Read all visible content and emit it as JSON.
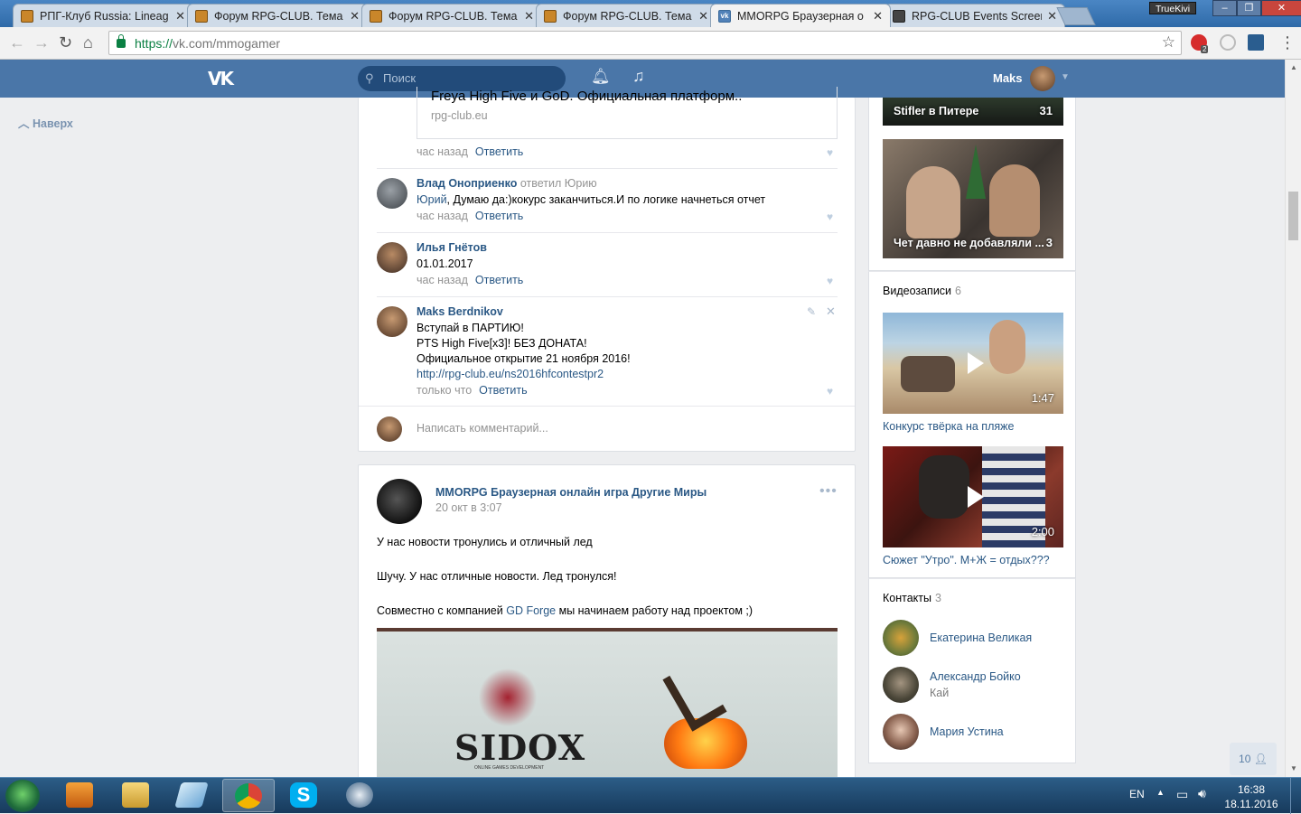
{
  "browser": {
    "tabs": [
      {
        "title": "РПГ-Клуб Russia: Lineag",
        "icon": "rpg-club-icon"
      },
      {
        "title": "Форум RPG-CLUB. Тема",
        "icon": "rpg-club-icon"
      },
      {
        "title": "Форум RPG-CLUB. Тема",
        "icon": "rpg-club-icon"
      },
      {
        "title": "Форум RPG-CLUB. Тема",
        "icon": "rpg-club-icon"
      },
      {
        "title": "MMORPG Браузерная о",
        "icon": "vk-icon"
      },
      {
        "title": "RPG-CLUB Events Screen",
        "icon": "events-icon"
      }
    ],
    "close_glyph": "✕",
    "profile_badge": "TrueKivi",
    "url_scheme": "https://",
    "url_rest": "vk.com/mmogamer",
    "extension_badge": "2"
  },
  "vk": {
    "logo": "VK",
    "search_placeholder": "Поиск",
    "user_name": "Maks",
    "up_nav": "Наверх"
  },
  "feed": {
    "link_snippet": {
      "title": "Freya High Five и GoD. Официальная платформ..",
      "domain": "rpg-club.eu"
    },
    "first_meta": {
      "time": "час назад",
      "reply": "Ответить"
    },
    "comments": [
      {
        "name": "Влад Оноприенко",
        "sub": "ответил Юрию",
        "lines": [
          "Юрий, Думаю да:)кокурс заканчиться.И по логике начнеться отчет"
        ],
        "link_word": "Юрий",
        "time": "час назад",
        "reply": "Ответить"
      },
      {
        "name": "Илья Гнётов",
        "lines": [
          "01.01.2017"
        ],
        "time": "час назад",
        "reply": "Ответить"
      },
      {
        "name": "Maks Berdnikov",
        "lines": [
          "Вступай в ПАРТИЮ!",
          "PTS High Five[x3]! БЕЗ ДОНАТА!",
          "Официальное открытие 21 ноября 2016!"
        ],
        "link": "http://rpg-club.eu/ns2016hfcontestpr2",
        "time": "только что",
        "reply": "Ответить"
      }
    ],
    "comment_placeholder": "Написать комментарий...",
    "post": {
      "author": "MMORPG Браузерная онлайн игра Другие Миры",
      "date": "20 окт в 3:07",
      "para1": "У нас новости тронулись и отличный лед",
      "para2": "Шучу. У нас отличные новости. Лед тронулся!",
      "para3_before": "Совместно с компанией ",
      "para3_link": "GD Forge",
      "para3_after": " мы начинаем работу над проектом ;)",
      "image_text": "SIDOX",
      "image_subtext": "ONLINE GAMES DEVELOPMENT"
    }
  },
  "sidebar": {
    "albums": [
      {
        "caption": "Stifler в Питере",
        "count": "31"
      },
      {
        "caption": "Чет давно не добавляли ...",
        "count": "3"
      }
    ],
    "videos_label": "Видеозаписи",
    "videos_count": "6",
    "videos": [
      {
        "title": "Конкурс твёрка на пляже",
        "duration": "1:47"
      },
      {
        "title": "Сюжет \"Утро\". М+Ж = отдых???",
        "duration": "2:00"
      }
    ],
    "contacts_label": "Контакты",
    "contacts_count": "3",
    "contacts": [
      {
        "name": "Екатерина Великая",
        "sub": ""
      },
      {
        "name": "Александр Бойко",
        "sub": "Кай"
      },
      {
        "name": "Мария Устина",
        "sub": ""
      }
    ],
    "friends_online": "10"
  },
  "taskbar": {
    "lang": "EN",
    "time": "16:38",
    "date": "18.11.2016"
  },
  "colors": {
    "vk_blue": "#4a76a8",
    "link": "#2a5885",
    "meta": "#939393"
  }
}
